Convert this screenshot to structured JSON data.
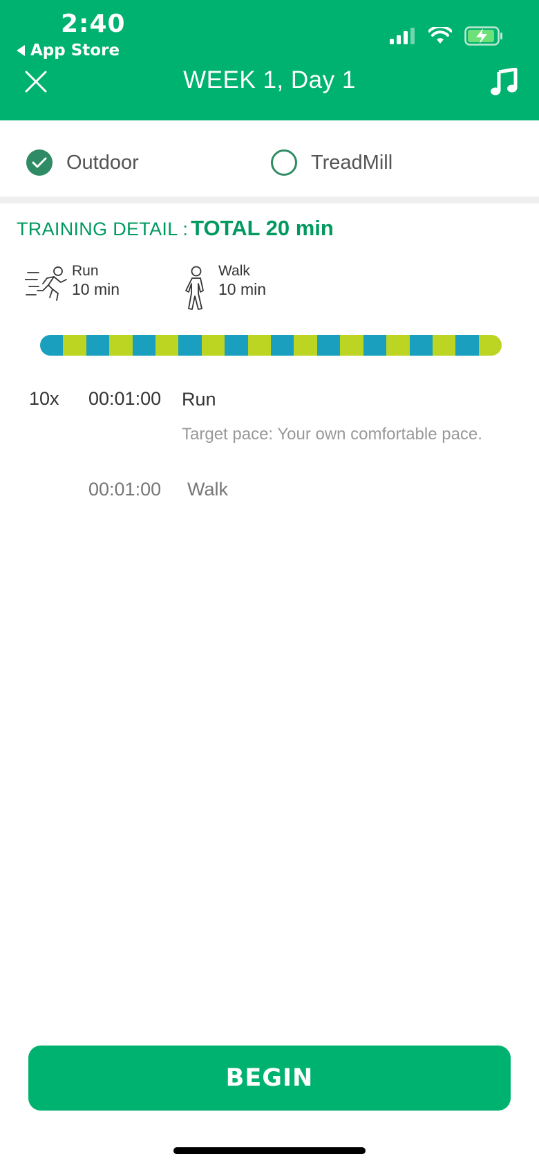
{
  "status_bar": {
    "time": "2:40",
    "back_label": "App Store",
    "icons": [
      "cellular-signal-icon",
      "wifi-icon",
      "battery-charging-icon"
    ]
  },
  "header": {
    "title": "WEEK 1, Day 1",
    "close_icon": "close-icon",
    "music_icon": "music-note-icon"
  },
  "modes": {
    "outdoor": {
      "label": "Outdoor",
      "selected": true
    },
    "treadmill": {
      "label": "TreadMill",
      "selected": false
    }
  },
  "training": {
    "label": "TRAINING DETAIL : ",
    "total": "TOTAL 20 min",
    "run": {
      "label": "Run",
      "duration": "10 min",
      "icon": "running-person-icon"
    },
    "walk": {
      "label": "Walk",
      "duration": "10 min",
      "icon": "walking-person-icon"
    }
  },
  "progress": {
    "pattern": [
      "run",
      "walk",
      "run",
      "walk",
      "run",
      "walk",
      "run",
      "walk",
      "run",
      "walk",
      "run",
      "walk",
      "run",
      "walk",
      "run",
      "walk",
      "run",
      "walk",
      "run",
      "walk"
    ],
    "colors": {
      "run": "#1a9fbf",
      "walk": "#bcd422"
    }
  },
  "intervals": {
    "repeat": "10x",
    "run": {
      "time": "00:01:00",
      "name": "Run",
      "pace": "Target pace: Your own comfortable pace."
    },
    "walk": {
      "time": "00:01:00",
      "name": "Walk"
    }
  },
  "actions": {
    "begin_label": "BEGIN"
  },
  "colors": {
    "brand": "#00b26f",
    "accent_dark": "#2e8b64",
    "title_text": "#00995f"
  }
}
